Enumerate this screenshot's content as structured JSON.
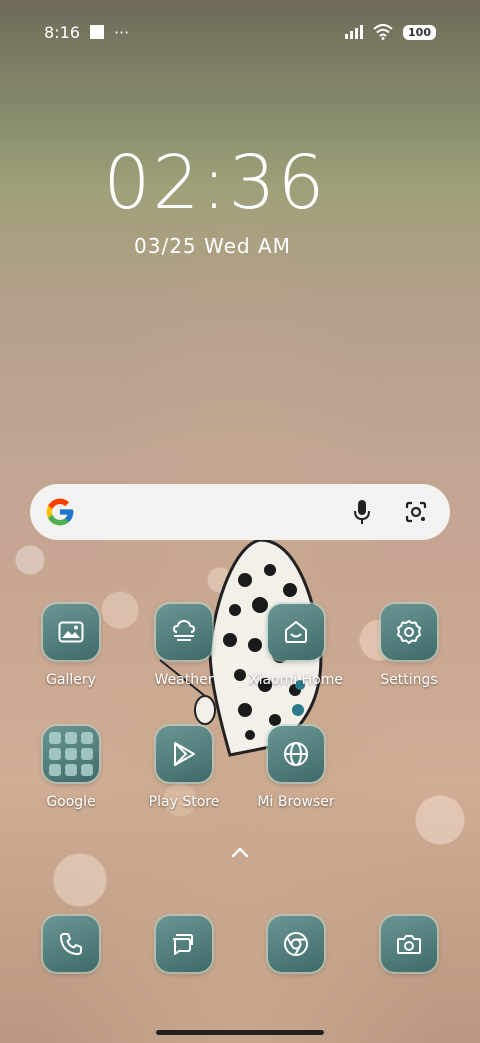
{
  "status_bar": {
    "time": "8:16",
    "more": "···",
    "battery": "100"
  },
  "lockscreen_clock": {
    "time": "02:36",
    "date_digits": "03/25",
    "weekday": "Wed",
    "ampm": "AM"
  },
  "search_bar": {
    "logo": "google-g-icon",
    "mic": "microphone-icon",
    "lens": "lens-camera-icon"
  },
  "apps_row1": [
    {
      "label": "Gallery",
      "icon": "gallery-icon"
    },
    {
      "label": "Weather",
      "icon": "weather-icon"
    },
    {
      "label": "Xiaomi Home",
      "icon": "xiaomi-home-icon"
    },
    {
      "label": "Settings",
      "icon": "gear-icon"
    }
  ],
  "apps_row2": [
    {
      "label": "Google",
      "icon": "folder-icon"
    },
    {
      "label": "Play Store",
      "icon": "play-store-icon"
    },
    {
      "label": "Mi Browser",
      "icon": "globe-icon"
    }
  ],
  "dock": [
    {
      "icon": "phone-icon"
    },
    {
      "icon": "messages-icon"
    },
    {
      "icon": "chrome-icon"
    },
    {
      "icon": "camera-icon"
    }
  ]
}
